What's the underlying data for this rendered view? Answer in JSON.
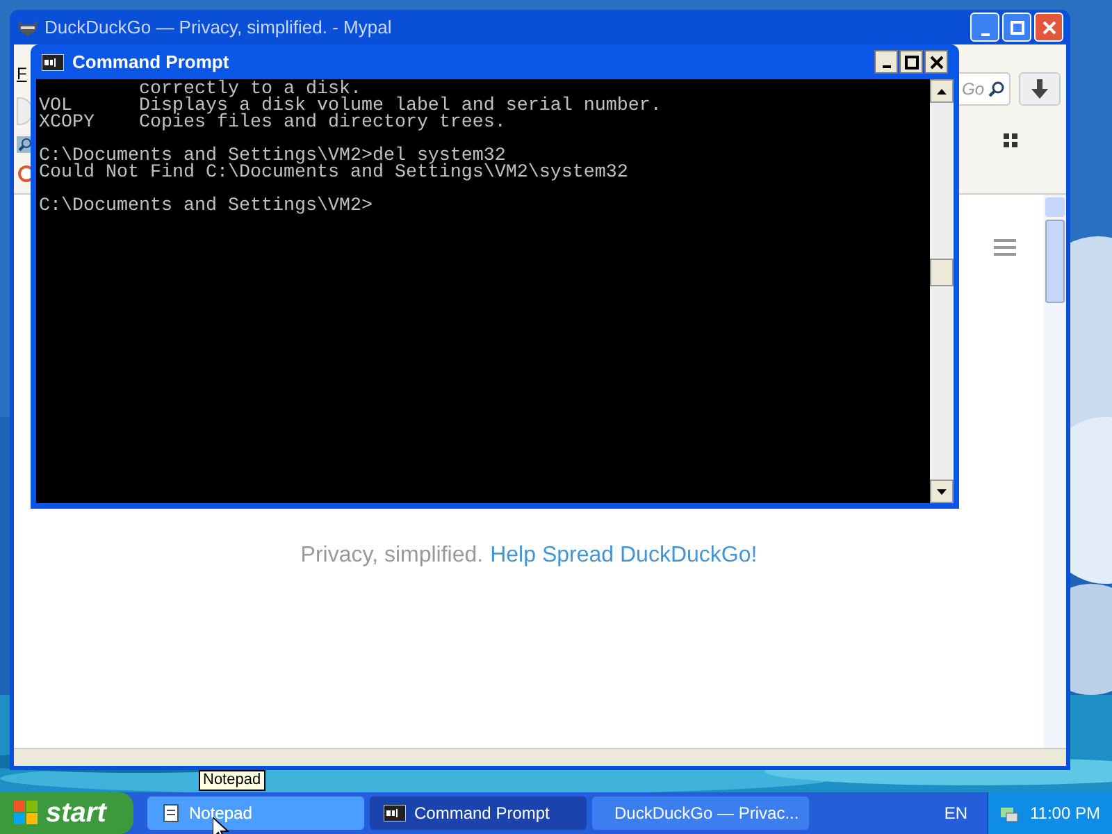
{
  "browser": {
    "title": "DuckDuckGo — Privacy, simplified. - Mypal",
    "menu_letter": "F",
    "search_placeholder": "Go",
    "tagline": "Privacy, simplified.",
    "link": "Help Spread DuckDuckGo!"
  },
  "console": {
    "title": "Command Prompt",
    "blocks": [
      [
        "         correctly to a disk.",
        "VOL      Displays a disk volume label and serial number.",
        "XCOPY    Copies files and directory trees."
      ],
      [
        "C:\\Documents and Settings\\VM2>del system32",
        "Could Not Find C:\\Documents and Settings\\VM2\\system32"
      ],
      [
        "C:\\Documents and Settings\\VM2>"
      ]
    ]
  },
  "tooltip": "Notepad",
  "taskbar": {
    "start": "start",
    "tasks": [
      {
        "label": "Notepad",
        "kind": "notepad",
        "selected": false,
        "hovered": true
      },
      {
        "label": "Command Prompt",
        "kind": "console",
        "selected": true,
        "hovered": false
      },
      {
        "label": "DuckDuckGo — Privac...",
        "kind": "browser",
        "selected": false,
        "hovered": false
      }
    ],
    "language": "EN",
    "clock": "11:00 PM"
  }
}
